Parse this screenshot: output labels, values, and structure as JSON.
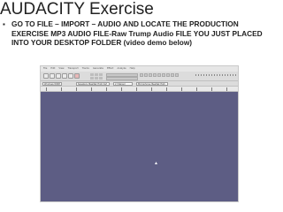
{
  "slide": {
    "title": "AUDACITY Exercise",
    "bullet_marker": "▪",
    "bullet_text": "GO TO FILE – IMPORT – AUDIO AND LOCATE THE PRODUCTION EXERCISE MP3 AUDIO FILE-Raw Trump Audio FILE YOU JUST PLACED INTO YOUR DESKTOP FOLDER (video demo below)"
  },
  "app": {
    "name": "Audacity",
    "menu": [
      "File",
      "Edit",
      "View",
      "Transport",
      "Tracks",
      "Generate",
      "Effect",
      "Analyze",
      "Help"
    ],
    "device_toolbar": {
      "host": "Windows WDM",
      "output": "Speakers (Realtek High Def",
      "channels": "2 (Stereo)",
      "input": "Microphone (Realtek High"
    },
    "track_area_color": "#5d5d84",
    "cursor": "arrow-cursor-icon"
  }
}
